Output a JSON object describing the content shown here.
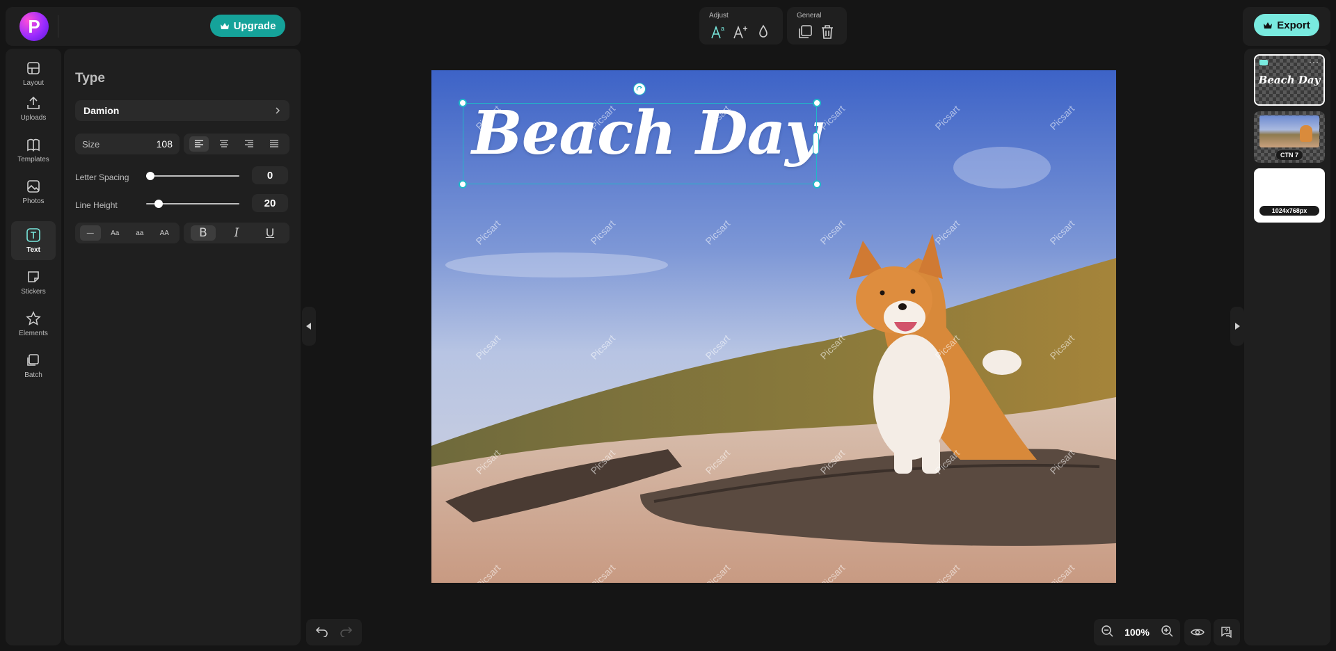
{
  "brand": {
    "logo_letter": "P",
    "upgrade_label": "Upgrade",
    "export_label": "Export"
  },
  "nav": {
    "items": [
      {
        "label": "Layout",
        "icon": "layout-icon"
      },
      {
        "label": "Uploads",
        "icon": "upload-icon"
      },
      {
        "label": "Templates",
        "icon": "templates-icon"
      },
      {
        "label": "Photos",
        "icon": "photo-icon"
      },
      {
        "label": "Text",
        "icon": "text-icon",
        "active": true
      },
      {
        "label": "Stickers",
        "icon": "sticker-icon"
      },
      {
        "label": "Elements",
        "icon": "star-icon"
      },
      {
        "label": "Batch",
        "icon": "batch-icon"
      }
    ]
  },
  "type_panel": {
    "title": "Type",
    "font": "Damion",
    "size_label": "Size",
    "size_value": "108",
    "letter_spacing_label": "Letter Spacing",
    "letter_spacing_value": "0",
    "letter_spacing_fraction": 0.0,
    "line_height_label": "Line Height",
    "line_height_value": "20",
    "line_height_fraction": 0.1,
    "align_options": [
      "left",
      "center",
      "right",
      "justify"
    ],
    "align_selected": "left",
    "case_options": [
      "—",
      "Aa",
      "aa",
      "AA"
    ],
    "case_selected": "—",
    "style_options": [
      "B",
      "I",
      "U"
    ],
    "style_selected": "B"
  },
  "toolbar": {
    "adjust_label": "Adjust",
    "general_label": "General"
  },
  "canvas": {
    "headline": "Beach Day",
    "watermark": "Picsart"
  },
  "layers": [
    {
      "type": "text",
      "preview": "Beach Day"
    },
    {
      "type": "image",
      "label": "CTN 7"
    },
    {
      "type": "background",
      "label": "1024x768px"
    }
  ],
  "zoom": {
    "value": "100%"
  },
  "colors": {
    "accent": "#15a39a",
    "export": "#79eadf",
    "selection": "#20b8c8"
  }
}
